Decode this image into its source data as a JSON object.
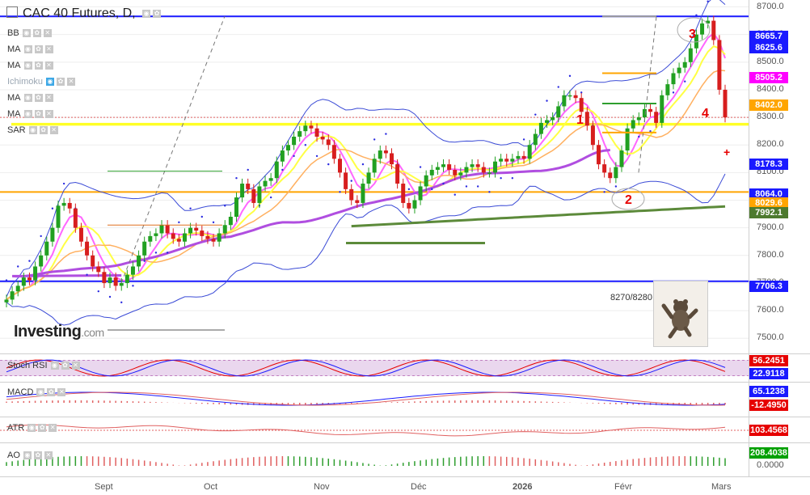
{
  "header": {
    "title": "CAC 40 Futures, D,"
  },
  "indicators_overlay": [
    "BB",
    "MA",
    "MA",
    "Ichimoku",
    "MA",
    "MA",
    "SAR"
  ],
  "indicator_panes": [
    {
      "name": "Stoch RSI",
      "values": [
        "56.2451",
        "22.9118"
      ],
      "colors": [
        "#e60000",
        "#1a1aff"
      ]
    },
    {
      "name": "MACD",
      "values": [
        "65.1238",
        "-12.4950"
      ],
      "colors": [
        "#1a1aff",
        "#e60000"
      ]
    },
    {
      "name": "ATR",
      "values": [
        "103.4568"
      ],
      "colors": [
        "#e60000"
      ]
    },
    {
      "name": "AO",
      "values": [
        "208.4038",
        "0.0000"
      ],
      "colors": [
        "#00a000",
        "none"
      ]
    }
  ],
  "price_tags": [
    {
      "value": "8665.7",
      "color": "#1a1aff"
    },
    {
      "value": "8625.6",
      "color": "#1a1aff"
    },
    {
      "value": "8505.2",
      "color": "#ff00ff"
    },
    {
      "value": "8402.0",
      "color": "#ffa500"
    },
    {
      "value": "8178.3",
      "color": "#1a1aff"
    },
    {
      "value": "8064.0",
      "color": "#1a1aff"
    },
    {
      "value": "8029.6",
      "color": "#ffa500"
    },
    {
      "value": "7992.1",
      "color": "#4d7a2e"
    },
    {
      "value": "7706.3",
      "color": "#1a1aff"
    }
  ],
  "annotations": [
    "1",
    "2",
    "3",
    "4"
  ],
  "range_label": "8270/8280",
  "logo": {
    "main": "Investing",
    "suffix": ".com"
  },
  "plus_marker": "+",
  "chart_data": {
    "type": "candlestick",
    "title": "CAC 40 Futures, D,",
    "x_labels": [
      "Sept",
      "Oct",
      "Nov",
      "Déc",
      "2026",
      "Févr",
      "Mars"
    ],
    "y_ticks": [
      7500,
      7600,
      7700,
      7800,
      7900,
      8000,
      8100,
      8200,
      8300,
      8400,
      8500,
      8600,
      8700
    ],
    "y_tick_labels": [
      "7500.0",
      "7600.0",
      "7700.0",
      "7800.0",
      "7900.0",
      "8000.0",
      "8100.0",
      "8200.0",
      "8300.0",
      "8400.0",
      "8500.0",
      "8600.0",
      "8700.0"
    ],
    "ylim": [
      7445,
      8725
    ],
    "horizontal_levels": [
      {
        "value": 8665.7,
        "color": "#1a1aff",
        "style": "solid"
      },
      {
        "value": 8270,
        "value2": 8280,
        "color": "#ffff00",
        "style": "band"
      },
      {
        "value": 8300,
        "color": "#e06060",
        "style": "dotted"
      },
      {
        "value": 8029.6,
        "color": "#ffa500",
        "style": "solid"
      },
      {
        "value": 7706.3,
        "color": "#1a1aff",
        "style": "solid"
      }
    ],
    "closes": [
      7640,
      7670,
      7690,
      7720,
      7710,
      7760,
      7800,
      7850,
      7900,
      7980,
      7990,
      7970,
      7900,
      7850,
      7800,
      7760,
      7740,
      7700,
      7720,
      7690,
      7700,
      7730,
      7760,
      7800,
      7850,
      7870,
      7880,
      7910,
      7880,
      7860,
      7850,
      7880,
      7900,
      7890,
      7870,
      7860,
      7850,
      7880,
      7910,
      7940,
      8010,
      8060,
      8040,
      7990,
      8050,
      8070,
      8080,
      8140,
      8180,
      8200,
      8230,
      8250,
      8270,
      8260,
      8230,
      8220,
      8200,
      8150,
      8100,
      8040,
      8000,
      7990,
      8060,
      8100,
      8150,
      8180,
      8170,
      8130,
      8060,
      7990,
      7970,
      8000,
      8050,
      8090,
      8110,
      8120,
      8130,
      8110,
      8090,
      8100,
      8120,
      8130,
      8120,
      8100,
      8100,
      8140,
      8150,
      8140,
      8150,
      8160,
      8150,
      8200,
      8240,
      8280,
      8290,
      8300,
      8340,
      8380,
      8380,
      8370,
      8320,
      8270,
      8200,
      8130,
      8100,
      8080,
      8120,
      8180,
      8260,
      8290,
      8300,
      8330,
      8320,
      8280,
      8380,
      8420,
      8460,
      8480,
      8500,
      8550,
      8600,
      8640,
      8650,
      8580,
      8400,
      8300
    ]
  }
}
